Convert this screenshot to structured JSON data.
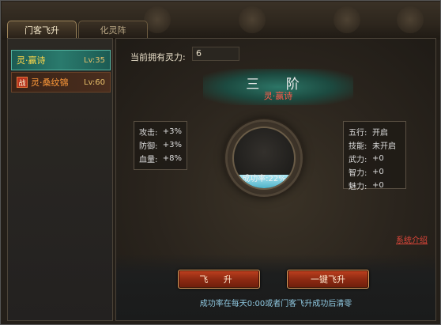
{
  "tabs": [
    {
      "label": "门客飞升",
      "active": true
    },
    {
      "label": "化灵阵",
      "active": false
    }
  ],
  "list": [
    {
      "name": "灵·赢诗",
      "level": "Lv:35",
      "selected": true,
      "badge": ""
    },
    {
      "name": "灵·桑纹锦",
      "level": "Lv:60",
      "selected": false,
      "badge": "战"
    }
  ],
  "spirit": {
    "label": "当前拥有灵力:",
    "value": "6"
  },
  "rank": {
    "title": "三 阶",
    "subtitle": "灵·赢诗"
  },
  "stats_left": [
    {
      "k": "攻击:",
      "v": "+3%"
    },
    {
      "k": "防御:",
      "v": "+3%"
    },
    {
      "k": "血量:",
      "v": "+8%"
    }
  ],
  "stats_right": [
    {
      "k": "五行:",
      "v": "开启"
    },
    {
      "k": "技能:",
      "v": "未开启"
    },
    {
      "k": "武力:",
      "v": "+0"
    },
    {
      "k": "智力:",
      "v": "+0"
    },
    {
      "k": "魅力:",
      "v": "+0"
    }
  ],
  "orb": {
    "text": "成功率:22%",
    "fraction": 0.22
  },
  "links": {
    "system_intro": "系统介绍"
  },
  "buttons": {
    "ascend": "飞 升",
    "one_click": "一键飞升"
  },
  "note": "成功率在每天0:00或者门客飞升成功后清零",
  "colors": {
    "accent_teal": "#2a7a6d",
    "button_red": "#8e2a12",
    "rank_sub": "#ff5a4a"
  }
}
